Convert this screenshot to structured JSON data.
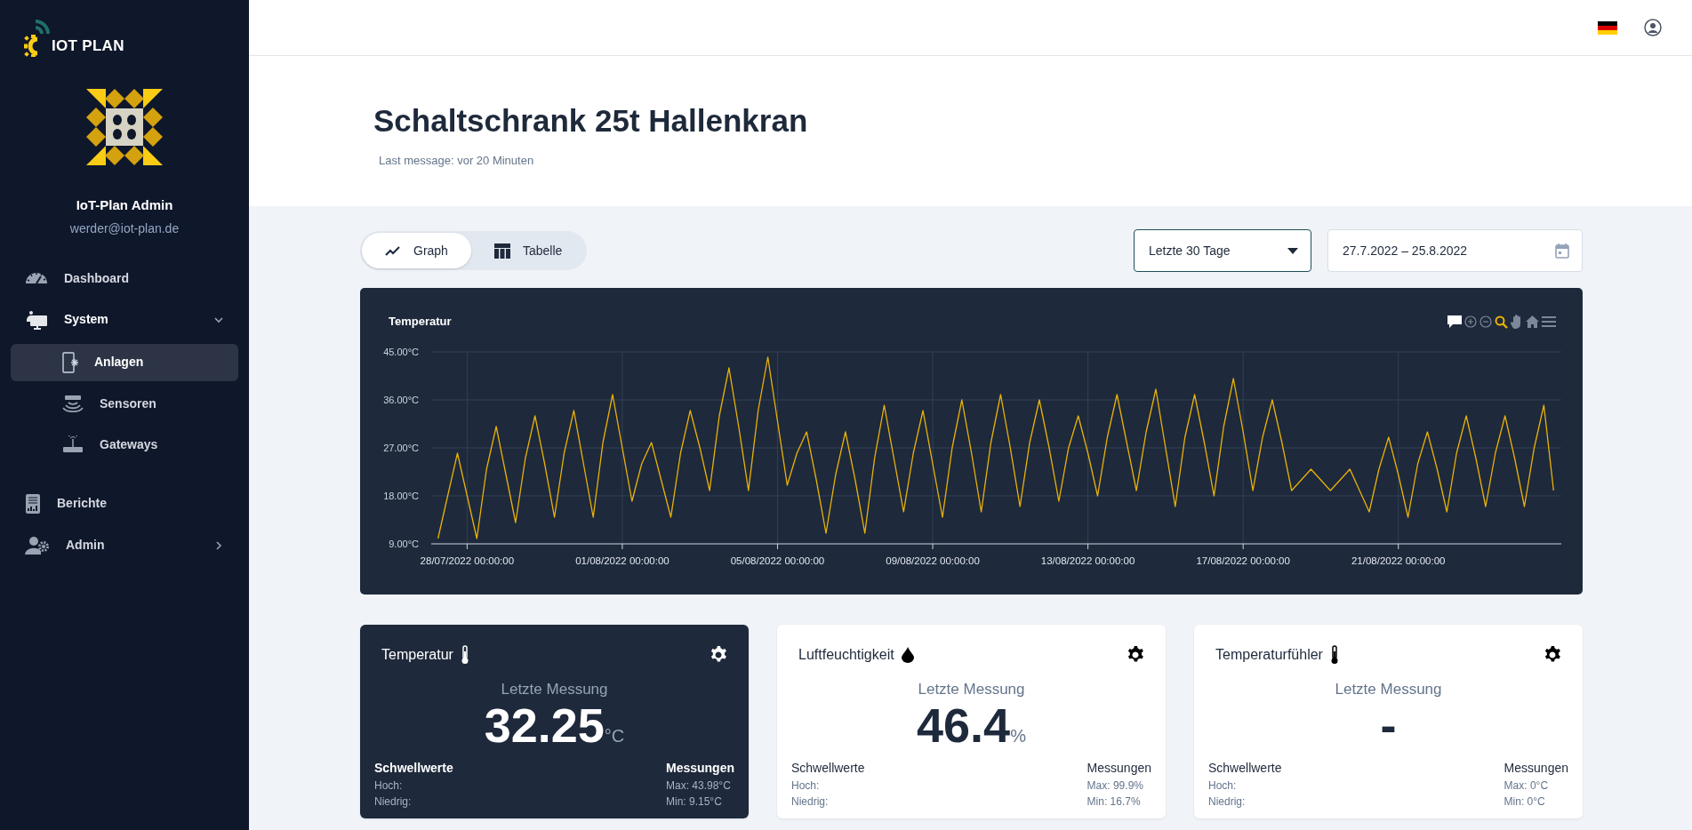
{
  "brand": {
    "name": "IOT PLAN"
  },
  "user": {
    "name": "IoT-Plan Admin",
    "email": "werder@iot-plan.de"
  },
  "nav": [
    {
      "kind": "dashboard",
      "label": "Dashboard",
      "selected": false
    },
    {
      "kind": "system",
      "label": "System",
      "selected": false,
      "expanded": true,
      "children": [
        {
          "kind": "plants",
          "label": "Anlagen",
          "selected": true
        },
        {
          "kind": "sensors",
          "label": "Sensoren",
          "selected": false
        },
        {
          "kind": "gateways",
          "label": "Gateways",
          "selected": false
        }
      ]
    },
    {
      "kind": "reports",
      "label": "Berichte",
      "selected": false
    },
    {
      "kind": "admin",
      "label": "Admin",
      "selected": false,
      "expanded": false
    }
  ],
  "page": {
    "title": "Schaltschrank 25t Hallenkran",
    "last_message": "Last message: vor 20 Minuten"
  },
  "view_tabs": [
    {
      "kind": "graph",
      "label": "Graph",
      "selected": true
    },
    {
      "kind": "table",
      "label": "Tabelle",
      "selected": false
    }
  ],
  "range_select": {
    "value": "Letzte 30 Tage"
  },
  "date_range": {
    "value": "27.7.2022 – 25.8.2022"
  },
  "chart": {
    "toolbar": [
      {
        "kind": "comment",
        "selected": false
      },
      {
        "kind": "zoom-in",
        "selected": false
      },
      {
        "kind": "zoom-out",
        "selected": false
      },
      {
        "kind": "zoom",
        "selected": true
      },
      {
        "kind": "pan",
        "selected": false
      },
      {
        "kind": "reset",
        "selected": false
      },
      {
        "kind": "menu",
        "selected": false
      }
    ],
    "chart_data": {
      "type": "line",
      "title": "Temperatur",
      "grid": true,
      "categories": [
        null,
        null,
        null,
        "28/07/2022 00:00:00",
        null,
        null,
        null,
        null,
        null,
        null,
        null,
        null,
        null,
        null,
        null,
        null,
        null,
        null,
        null,
        "01/08/2022 00:00:00",
        null,
        null,
        null,
        null,
        null,
        null,
        null,
        null,
        null,
        null,
        null,
        null,
        null,
        null,
        null,
        "05/08/2022 00:00:00",
        null,
        null,
        null,
        null,
        null,
        null,
        null,
        null,
        null,
        null,
        null,
        null,
        null,
        null,
        null,
        "09/08/2022 00:00:00",
        null,
        null,
        null,
        null,
        null,
        null,
        null,
        null,
        null,
        null,
        null,
        null,
        null,
        null,
        null,
        "13/08/2022 00:00:00",
        null,
        null,
        null,
        null,
        null,
        null,
        null,
        null,
        null,
        null,
        null,
        null,
        null,
        null,
        null,
        "17/08/2022 00:00:00",
        null,
        null,
        null,
        null,
        null,
        null,
        null,
        null,
        null,
        null,
        null,
        null,
        null,
        null,
        null,
        "21/08/2022 00:00:00",
        null,
        null,
        null,
        null,
        null,
        null,
        null,
        null,
        null,
        null,
        null,
        null,
        null,
        null,
        null,
        null
      ],
      "series": [
        {
          "color": "#eab308",
          "values": [
            10,
            18,
            26,
            18,
            10,
            23,
            31,
            22,
            13,
            25,
            33,
            24,
            14,
            26,
            34,
            24,
            14,
            28,
            37,
            27,
            17,
            24,
            28,
            21,
            14,
            26,
            34,
            27,
            19,
            33,
            42,
            31,
            19,
            34,
            44,
            32,
            20,
            26,
            30,
            21,
            11,
            22,
            30,
            21,
            11,
            25,
            35,
            25,
            15,
            26,
            34,
            24,
            14,
            27,
            36,
            26,
            15,
            28,
            37,
            27,
            16,
            28,
            36,
            27,
            17,
            27,
            33,
            26,
            18,
            29,
            37,
            28,
            19,
            30,
            38,
            27,
            16,
            29,
            37,
            28,
            18,
            31,
            40,
            30,
            19,
            29,
            36,
            28,
            19,
            21,
            23,
            21,
            19,
            21,
            23,
            19,
            15,
            23,
            29,
            22,
            14,
            24,
            30,
            23,
            15,
            26,
            33,
            25,
            16,
            26,
            33,
            25,
            16,
            27,
            35,
            19
          ]
        }
      ],
      "ylim": [
        9,
        45
      ],
      "yticks": [
        {
          "value": 9,
          "label": "9.00°C"
        },
        {
          "value": 18,
          "label": "18.00°C"
        },
        {
          "value": 27,
          "label": "27.00°C"
        },
        {
          "value": 36,
          "label": "36.00°C"
        },
        {
          "value": 45,
          "label": "45.00°C"
        }
      ]
    }
  },
  "cards": [
    {
      "kind": "temperature",
      "title": "Temperatur",
      "selected": true,
      "caption": "Letzte Messung",
      "value": "32.25",
      "unit": "°C",
      "thresholds_label": "Schwellwerte",
      "high": "Hoch:",
      "low": "Niedrig:",
      "measurements_label": "Messungen",
      "max": "Max: 43.98°C",
      "min": "Min: 9.15°C"
    },
    {
      "kind": "humidity",
      "title": "Luftfeuchtigkeit",
      "selected": false,
      "caption": "Letzte Messung",
      "value": "46.4",
      "unit": "%",
      "thresholds_label": "Schwellwerte",
      "high": "Hoch:",
      "low": "Niedrig:",
      "measurements_label": "Messungen",
      "max": "Max: 99.9%",
      "min": "Min: 16.7%"
    },
    {
      "kind": "temperature",
      "title": "Temperaturfühler",
      "selected": false,
      "caption": "Letzte Messung",
      "value": "-",
      "thresholds_label": "Schwellwerte",
      "high": "Hoch:",
      "low": "Niedrig:",
      "measurements_label": "Messungen",
      "max": "Max: 0°C",
      "min": "Min: 0°C"
    }
  ]
}
